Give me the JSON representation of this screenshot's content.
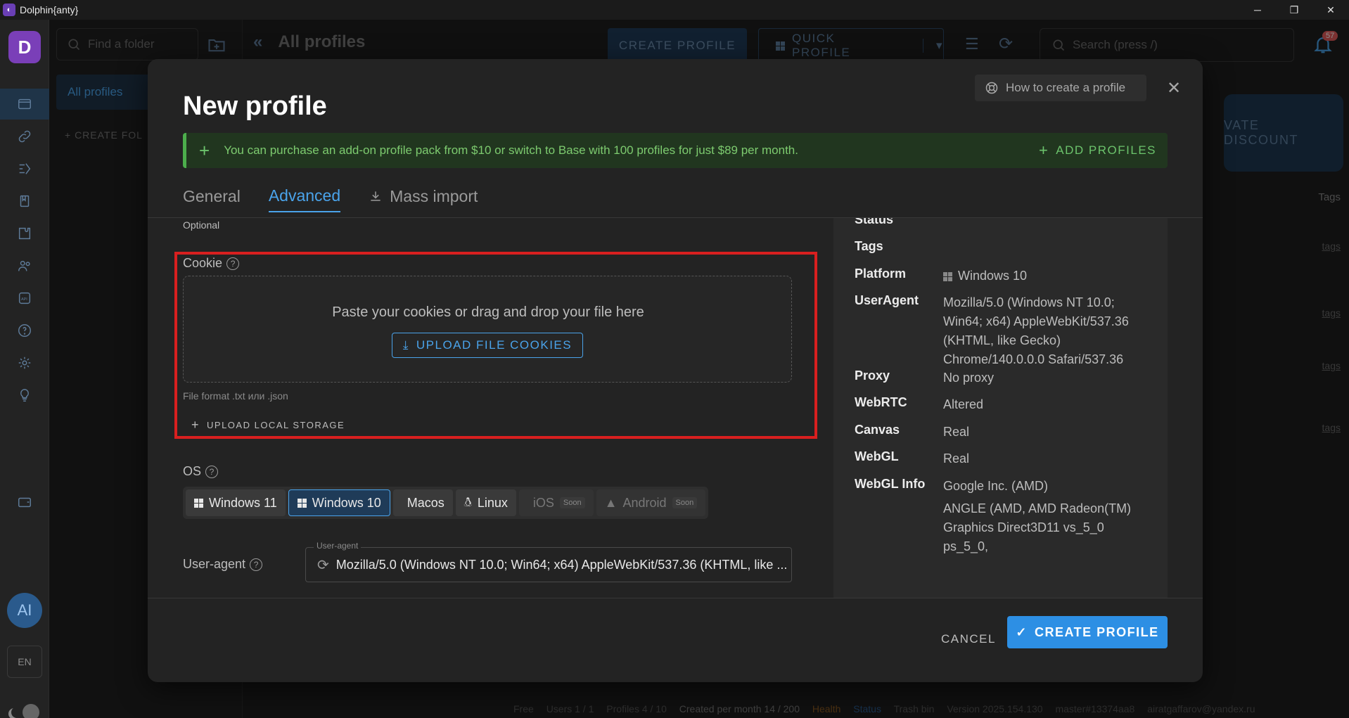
{
  "window": {
    "app_title": "Dolphin{anty}",
    "app_icon": "dolphin-logo",
    "minimize": "─",
    "restore": "❐",
    "close": "✕"
  },
  "rail": {
    "logo_letter": "D",
    "avatar": "AI",
    "lang": "EN"
  },
  "folders": {
    "search_placeholder": "Find a folder",
    "all_profiles": "All profiles",
    "create_folder": "+ CREATE FOL"
  },
  "header": {
    "title": "All profiles",
    "create_profile": "CREATE PROFILE",
    "quick_profile": "QUICK PROFILE",
    "search_placeholder": "Search (press /)",
    "notifications": "57",
    "discount": "VATE DISCOUNT",
    "tags_col": "Tags",
    "tags_cell": "tags"
  },
  "status_bar": {
    "plan": "Free",
    "users": "Users 1 / 1",
    "profiles": "Profiles 4 / 10",
    "created": "Created per month 14 / 200",
    "health": "Health",
    "status": "Status",
    "trash": "Trash bin",
    "version": "Version 2025.154.130",
    "build": "master#13374aa8",
    "email": "airatgaffarov@yandex.ru"
  },
  "modal": {
    "title": "New profile",
    "howto": "How to create a profile",
    "close": "✕",
    "banner": {
      "text": "You can purchase an add-on profile pack from $10 or switch to Base with 100 profiles for just $89 per month.",
      "action": "ADD PROFILES"
    },
    "tabs": [
      "General",
      "Advanced",
      "Mass import"
    ],
    "optional": "Optional",
    "cookie": {
      "label": "Cookie",
      "dropzone_text": "Paste your cookies or drag and drop your file here",
      "upload_button": "UPLOAD FILE COOKIES",
      "file_format": "File format .txt или .json",
      "upload_local": "UPLOAD LOCAL STORAGE"
    },
    "os": {
      "label": "OS",
      "options": [
        {
          "label": "Windows 11",
          "state": "normal"
        },
        {
          "label": "Windows 10",
          "state": "selected"
        },
        {
          "label": "Macos",
          "state": "normal"
        },
        {
          "label": "Linux",
          "state": "normal"
        },
        {
          "label": "iOS",
          "state": "soon"
        },
        {
          "label": "Android",
          "state": "soon"
        }
      ],
      "soon": "Soon"
    },
    "useragent": {
      "label": "User-agent",
      "floating_label": "User-agent",
      "value": "Mozilla/5.0 (Windows NT 10.0; Win64; x64) AppleWebKit/537.36 (KHTML, like ..."
    },
    "summary": {
      "status": "Status",
      "tags": "Tags",
      "platform_key": "Platform",
      "platform_val": "Windows 10",
      "ua_key": "UserAgent",
      "ua_val_1": "Mozilla/5.0 (Windows NT 10.0;",
      "ua_val_2": "Win64; x64) AppleWebKit/537.36",
      "ua_val_3": "(KHTML, like Gecko)",
      "ua_val_4": "Chrome/140.0.0.0 Safari/537.36",
      "proxy_key": "Proxy",
      "proxy_val": "No proxy",
      "webrtc_key": "WebRTC",
      "webrtc_val": "Altered",
      "canvas_key": "Canvas",
      "canvas_val": "Real",
      "webgl_key": "WebGL",
      "webgl_val": "Real",
      "webglinfo_key": "WebGL Info",
      "webglinfo_val_1": "Google Inc. (AMD)",
      "webglinfo_val_2": "ANGLE (AMD, AMD Radeon(TM)",
      "webglinfo_val_3": "Graphics Direct3D11 vs_5_0 ps_5_0,"
    },
    "cancel": "CANCEL",
    "create": "CREATE PROFILE"
  },
  "colors": {
    "accent": "#2d8fe4",
    "highlight": "#d81f1f",
    "banner_green": "#7dcb6f"
  }
}
